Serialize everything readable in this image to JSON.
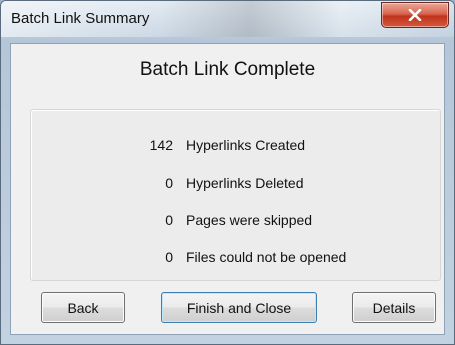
{
  "window": {
    "title": "Batch Link Summary"
  },
  "icons": {
    "close": "close-icon"
  },
  "heading": "Batch Link Complete",
  "stats": [
    {
      "count": "142",
      "label": "Hyperlinks Created"
    },
    {
      "count": "0",
      "label": "Hyperlinks Deleted"
    },
    {
      "count": "0",
      "label": "Pages were skipped"
    },
    {
      "count": "0",
      "label": "Files could not be opened"
    }
  ],
  "buttons": {
    "back": "Back",
    "finish": "Finish and Close",
    "details": "Details"
  },
  "colors": {
    "close_button": "#c7422a",
    "default_button_border": "#3c7fb1"
  }
}
